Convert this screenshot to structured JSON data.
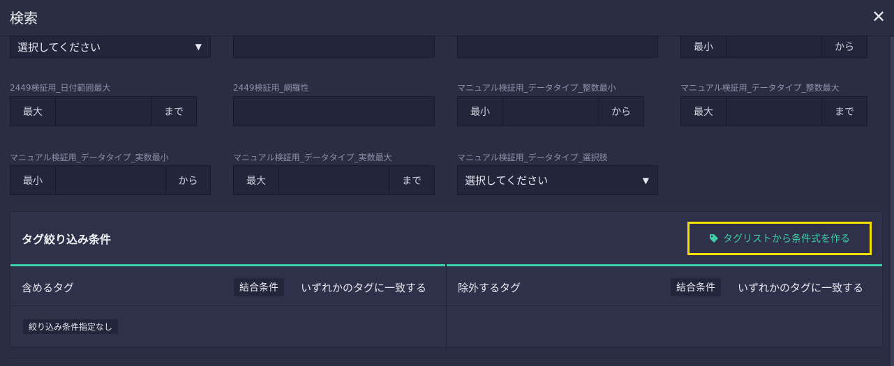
{
  "dialog": {
    "title": "検索",
    "close_glyph": "✕"
  },
  "row1": {
    "select_placeholder": "選択してください",
    "select_arrow": "▼",
    "min_label": "最小",
    "from_label": "から"
  },
  "row2": {
    "field1": {
      "label": "2449検証用_日付範囲最大",
      "prefix": "最大",
      "suffix": "まで"
    },
    "field2": {
      "label": "2449検証用_網羅性"
    },
    "field3": {
      "label": "マニュアル検証用_データタイプ_整数最小",
      "prefix": "最小",
      "suffix": "から"
    },
    "field4": {
      "label": "マニュアル検証用_データタイプ_整数最大",
      "prefix": "最大",
      "suffix": "まで"
    }
  },
  "row3": {
    "field1": {
      "label": "マニュアル検証用_データタイプ_実数最小",
      "prefix": "最小",
      "suffix": "から"
    },
    "field2": {
      "label": "マニュアル検証用_データタイプ_実数最大",
      "prefix": "最大",
      "suffix": "まで"
    },
    "field3": {
      "label": "マニュアル検証用_データタイプ_選択肢",
      "placeholder": "選択してください",
      "arrow": "▼"
    }
  },
  "tag_filter": {
    "title": "タグ絞り込み条件",
    "make_from_list_button": "タグリストから条件式を作る",
    "include": {
      "title": "含めるタグ",
      "combine_label": "結合条件",
      "combine_value": "いずれかのタグに一致する",
      "empty_text": "絞り込み条件指定なし"
    },
    "exclude": {
      "title": "除外するタグ",
      "combine_label": "結合条件",
      "combine_value": "いずれかのタグに一致する"
    }
  },
  "colors": {
    "accent": "#3fcea6",
    "highlight": "#f5e000",
    "background": "#2b2e43",
    "field": "#23263a"
  }
}
